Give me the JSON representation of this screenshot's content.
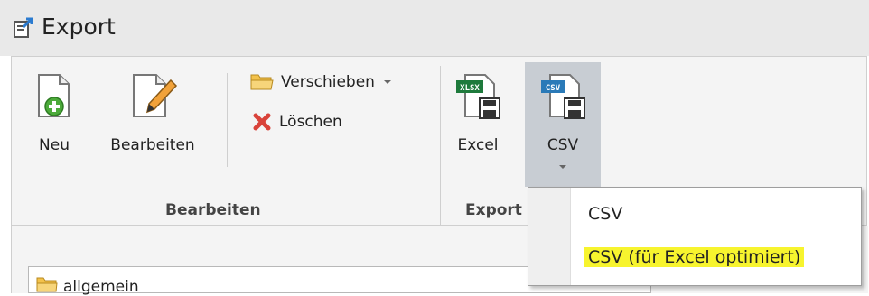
{
  "window": {
    "title": "Export",
    "icon": "export-icon"
  },
  "ribbon": {
    "neu": {
      "label": "Neu",
      "icon": "new-document-icon"
    },
    "bearbeiten": {
      "label": "Bearbeiten",
      "icon": "edit-document-icon"
    },
    "verschieben": {
      "label": "Verschieben",
      "icon": "folder-icon",
      "dropdown": "chevron-down-icon"
    },
    "loeschen": {
      "label": "Löschen",
      "icon": "delete-x-icon"
    },
    "excel": {
      "label": "Excel",
      "icon": "xlsx-save-icon",
      "badge": "XLSX"
    },
    "csv": {
      "label": "CSV",
      "icon": "csv-save-icon",
      "badge": "CSV"
    },
    "groups": {
      "bearbeiten": "Bearbeiten",
      "export": "Export"
    }
  },
  "folder_select": {
    "value": "allgemein",
    "icon": "folder-icon"
  },
  "csv_menu": {
    "items": [
      {
        "label": "CSV"
      },
      {
        "label": "CSV (für Excel optimiert)",
        "highlight_color": "#f7f42e"
      }
    ]
  },
  "colors": {
    "titlebar": "#e9e9e9",
    "ribbon": "#f4f4f4",
    "pressed_button": "#c8cdd3",
    "highlight": "#f7f42e",
    "plus_green": "#4caa3a",
    "delete_red": "#d9433a"
  }
}
